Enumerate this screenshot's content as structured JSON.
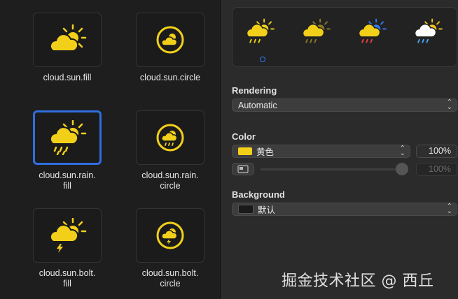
{
  "symbols": [
    {
      "name": "cloud.sun.fill",
      "line1": "cloud.sun.fill",
      "line2": ""
    },
    {
      "name": "cloud.sun.circle",
      "line1": "cloud.sun.circle",
      "line2": ""
    },
    {
      "name": "cloud.sun.rain.fill",
      "line1": "cloud.sun.rain.",
      "line2": "fill"
    },
    {
      "name": "cloud.sun.rain.circle",
      "line1": "cloud.sun.rain.",
      "line2": "circle"
    },
    {
      "name": "cloud.sun.bolt.fill",
      "line1": "cloud.sun.bolt.",
      "line2": "fill"
    },
    {
      "name": "cloud.sun.bolt.circle",
      "line1": "cloud.sun.bolt.",
      "line2": "circle"
    }
  ],
  "selected_symbol": "cloud.sun.rain.fill",
  "rendering": {
    "label": "Rendering",
    "value": "Automatic"
  },
  "color": {
    "label": "Color",
    "value": "黄色",
    "swatch": "#f2d01a",
    "opacity": "100%",
    "opacity2": "100%"
  },
  "background": {
    "label": "Background",
    "value": "默认",
    "swatch": "#1a1a1a"
  },
  "accent": "#f2d01a",
  "selection_color": "#2f6fe0",
  "watermark": "掘金技术社区 @ 西丘"
}
